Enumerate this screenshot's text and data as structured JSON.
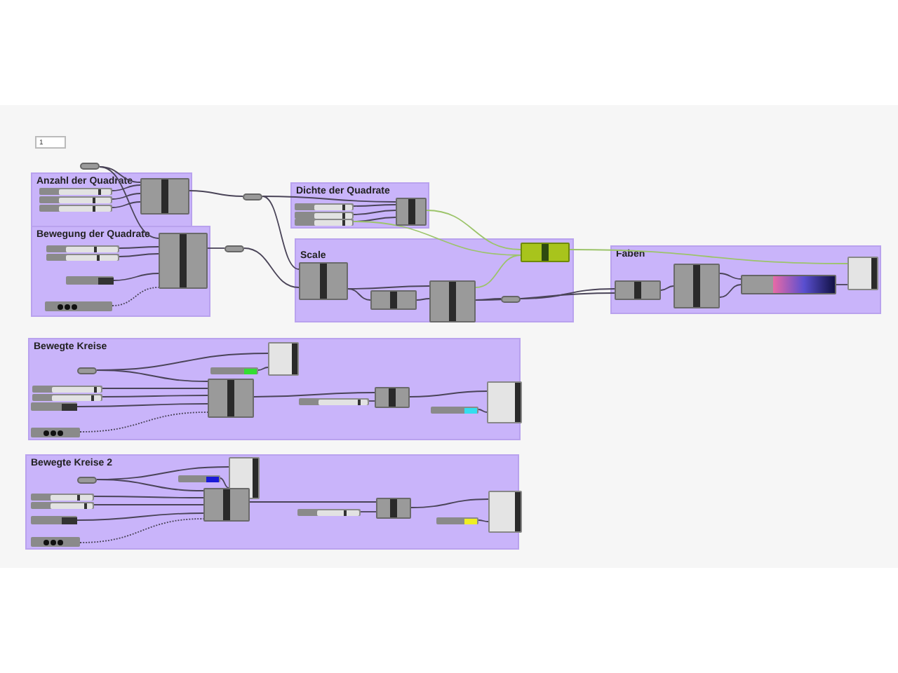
{
  "input_panel": {
    "value": "1"
  },
  "loose_nodes": [
    {
      "kind": "relay"
    },
    {
      "kind": "relay"
    },
    {
      "kind": "relay"
    }
  ],
  "groups": [
    {
      "title": "Anzahl der Quadrate",
      "nodes": [
        {
          "kind": "slider",
          "level": 0.8
        },
        {
          "kind": "slider",
          "level": 0.7
        },
        {
          "kind": "slider",
          "level": 0.7
        },
        {
          "kind": "component",
          "selected": false
        }
      ]
    },
    {
      "title": "Bewegung der Quadrate",
      "nodes": [
        {
          "kind": "slider",
          "level": 0.6
        },
        {
          "kind": "slider",
          "level": 0.65
        },
        {
          "kind": "toggle"
        },
        {
          "kind": "timer"
        },
        {
          "kind": "component",
          "selected": false
        }
      ]
    },
    {
      "title": "Dichte der Quadrate",
      "nodes": [
        {
          "kind": "slider",
          "level": 0.8
        },
        {
          "kind": "slider",
          "level": 0.8
        },
        {
          "kind": "slider",
          "level": 0.8
        },
        {
          "kind": "component",
          "selected": false
        }
      ]
    },
    {
      "title": "Scale",
      "nodes": [
        {
          "kind": "component",
          "selected": false
        },
        {
          "kind": "component",
          "selected": false
        },
        {
          "kind": "component",
          "selected": false
        },
        {
          "kind": "component",
          "selected": true
        },
        {
          "kind": "relay"
        }
      ]
    },
    {
      "title": "Faben",
      "nodes": [
        {
          "kind": "component",
          "selected": false
        },
        {
          "kind": "component",
          "selected": false
        },
        {
          "kind": "gradient"
        },
        {
          "kind": "preview"
        }
      ]
    },
    {
      "title": "Bewegte Kreise",
      "nodes": [
        {
          "kind": "relay"
        },
        {
          "kind": "preview"
        },
        {
          "kind": "swatch",
          "color": "#33dd33"
        },
        {
          "kind": "slider",
          "level": 0.9
        },
        {
          "kind": "slider",
          "level": 0.85
        },
        {
          "kind": "toggle"
        },
        {
          "kind": "timer"
        },
        {
          "kind": "component",
          "selected": false
        },
        {
          "kind": "component",
          "selected": false
        },
        {
          "kind": "slider",
          "level": 0.85
        },
        {
          "kind": "swatch",
          "color": "#33ddee"
        },
        {
          "kind": "preview"
        }
      ]
    },
    {
      "title": "Bewegte Kreise 2",
      "nodes": [
        {
          "kind": "relay"
        },
        {
          "kind": "preview"
        },
        {
          "kind": "swatch",
          "color": "#1a1ad8"
        },
        {
          "kind": "slider",
          "level": 0.7
        },
        {
          "kind": "slider",
          "level": 0.85
        },
        {
          "kind": "toggle"
        },
        {
          "kind": "timer"
        },
        {
          "kind": "component",
          "selected": false
        },
        {
          "kind": "component",
          "selected": false
        },
        {
          "kind": "slider",
          "level": 0.7
        },
        {
          "kind": "swatch",
          "color": "#eeee22"
        },
        {
          "kind": "preview"
        }
      ]
    }
  ]
}
